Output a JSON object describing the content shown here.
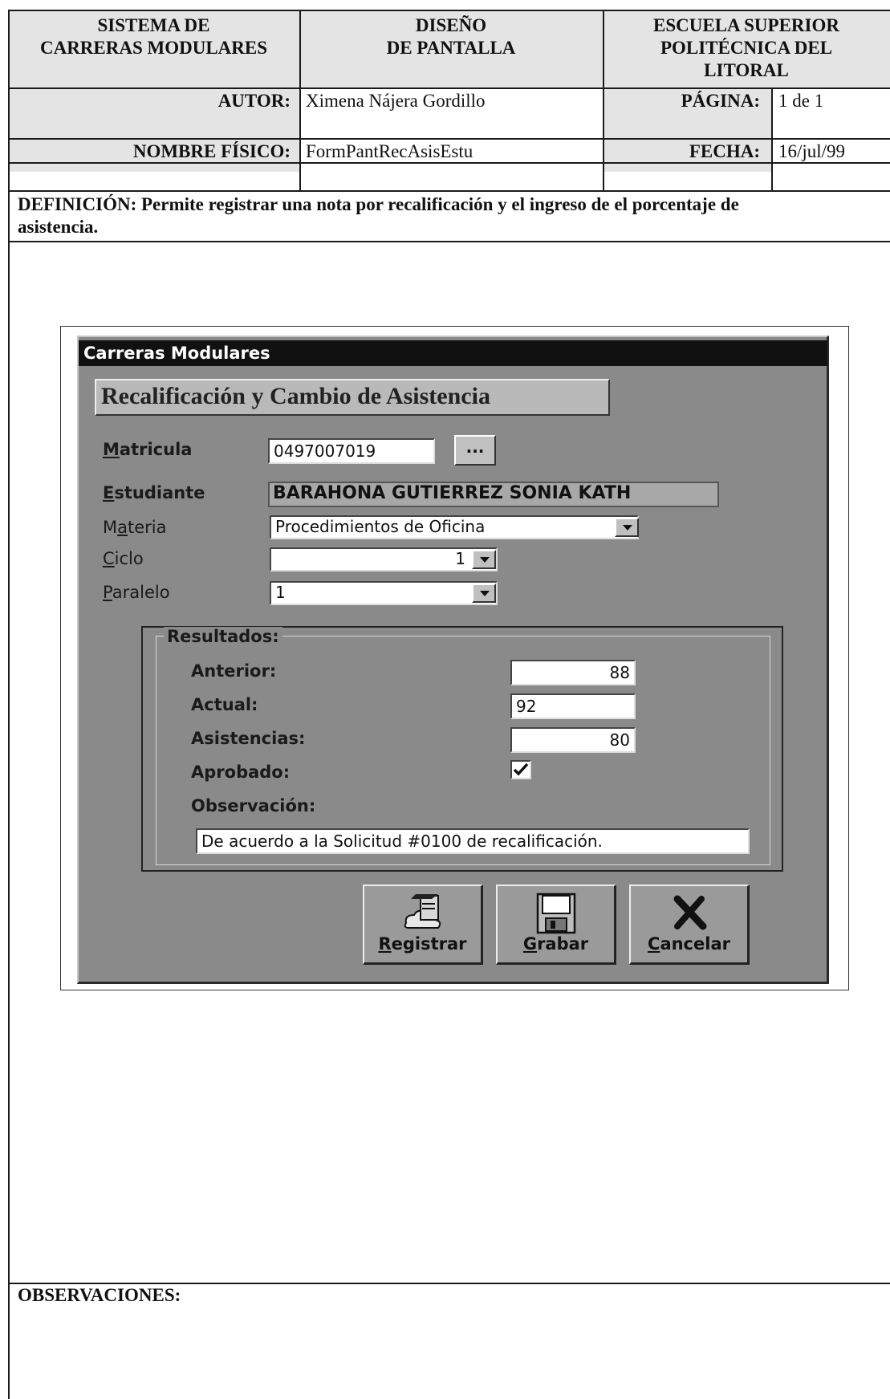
{
  "header": {
    "system": [
      "SISTEMA DE",
      "CARRERAS MODULARES"
    ],
    "design": [
      "DISEÑO",
      "DE PANTALLA"
    ],
    "school": [
      "ESCUELA SUPERIOR",
      "POLITÉCNICA DEL",
      "LITORAL"
    ],
    "author_label": "AUTOR:",
    "author_value": "Ximena Nájera Gordillo",
    "page_label": "PÁGINA:",
    "page_value": "1 de 1",
    "physical_label": "NOMBRE FÍSICO:",
    "physical_value": "FormPantRecAsisEstu",
    "date_label": "FECHA:",
    "date_value": "16/jul/99"
  },
  "definition": {
    "label": "DEFINICIÓN:",
    "text": "Permite registrar una nota por recalificación y el ingreso de el porcentaje de",
    "text_cont": "asistencia."
  },
  "window": {
    "title": "Carreras Modulares",
    "heading": "Recalificación y Cambio de Asistencia",
    "matricula": {
      "label_first": "M",
      "label_rest": "atricula",
      "value": "0497007019",
      "lookup": "..."
    },
    "estudiante": {
      "label_first": "E",
      "label_rest": "studiante",
      "value": "BARAHONA GUTIERREZ SONIA KATH"
    },
    "materia": {
      "label_a": "M",
      "label_u": "a",
      "label_b": "teria",
      "value": "Procedimientos de Oficina"
    },
    "ciclo": {
      "label_first": "C",
      "label_rest": "iclo",
      "value": "1"
    },
    "paralelo": {
      "label_first": "P",
      "label_rest": "aralelo",
      "value": "1"
    },
    "resultados": {
      "title": "Resultados:",
      "anterior_label": "Anterior:",
      "anterior_value": "88",
      "actual_label": "Actual:",
      "actual_value": "92",
      "asistencias_label": "Asistencias:",
      "asistencias_value": "80",
      "aprobado_label": "Aprobado:",
      "aprobado_checked": true,
      "observacion_label": "Observación:",
      "observacion_value": "De acuerdo a la Solicitud #0100 de recalificación."
    },
    "buttons": {
      "registrar_first": "R",
      "registrar_rest": "egistrar",
      "grabar_first": "G",
      "grabar_rest": "rabar",
      "cancelar_first": "C",
      "cancelar_rest": "ancelar"
    }
  },
  "observations": {
    "label": "OBSERVACIONES:"
  }
}
